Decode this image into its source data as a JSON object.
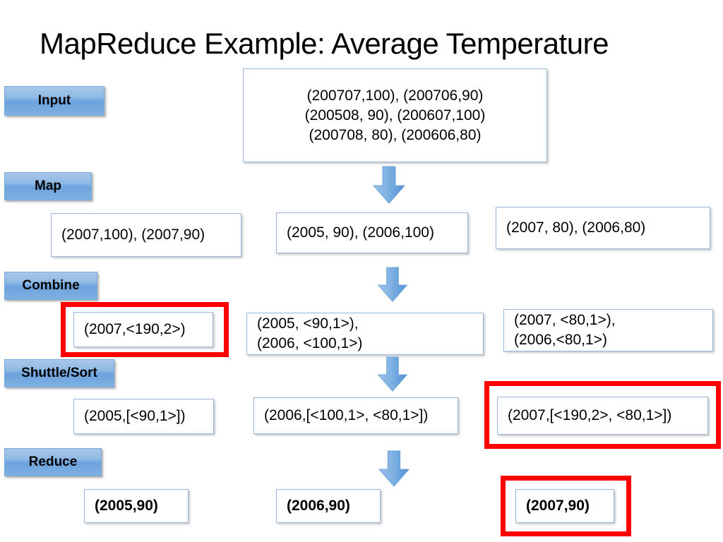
{
  "slide": {
    "title": "MapReduce Example: Average Temperature",
    "accent_blue": "#6ba3dd",
    "box_border": "#9bb7d8",
    "highlight_red": "#ff0000"
  },
  "stages": [
    {
      "id": "input",
      "label": "Input"
    },
    {
      "id": "map",
      "label": "Map"
    },
    {
      "id": "combine",
      "label": "Combine"
    },
    {
      "id": "shuffle",
      "label": "Shuttle/Sort"
    },
    {
      "id": "reduce",
      "label": "Reduce"
    }
  ],
  "rows": {
    "input": {
      "box": "(200707,100), (200706,90)\n(200508, 90), (200607,100)\n(200708, 80), (200606,80)"
    },
    "map": {
      "left": "(2007,100), (2007,90)",
      "middle": "(2005, 90), (2006,100)",
      "right": "(2007, 80), (2006,80)"
    },
    "combine": {
      "left": "(2007,<190,2>)",
      "middle": "(2005, <90,1>),\n(2006, <100,1>)",
      "right": "(2007, <80,1>),\n(2006,<80,1>)"
    },
    "shuffle": {
      "left": "(2005,[<90,1>])",
      "middle": "(2006,[<100,1>, <80,1>])",
      "right": "(2007,[<190,2>, <80,1>])"
    },
    "reduce": {
      "left": "(2005,90)",
      "middle": "(2006,90)",
      "right": "(2007,90)"
    }
  },
  "arrows": [
    {
      "id": "arrow-input-to-map",
      "label": "down-arrow"
    },
    {
      "id": "arrow-map-to-combine",
      "label": "down-arrow"
    },
    {
      "id": "arrow-combine-to-shuffle",
      "label": "down-arrow"
    },
    {
      "id": "arrow-shuffle-to-reduce",
      "label": "down-arrow"
    }
  ],
  "highlights": [
    {
      "id": "highlight-combine-left",
      "target": "combine.left"
    },
    {
      "id": "highlight-shuffle-right",
      "target": "shuffle.right"
    },
    {
      "id": "highlight-reduce-right",
      "target": "reduce.right"
    }
  ]
}
